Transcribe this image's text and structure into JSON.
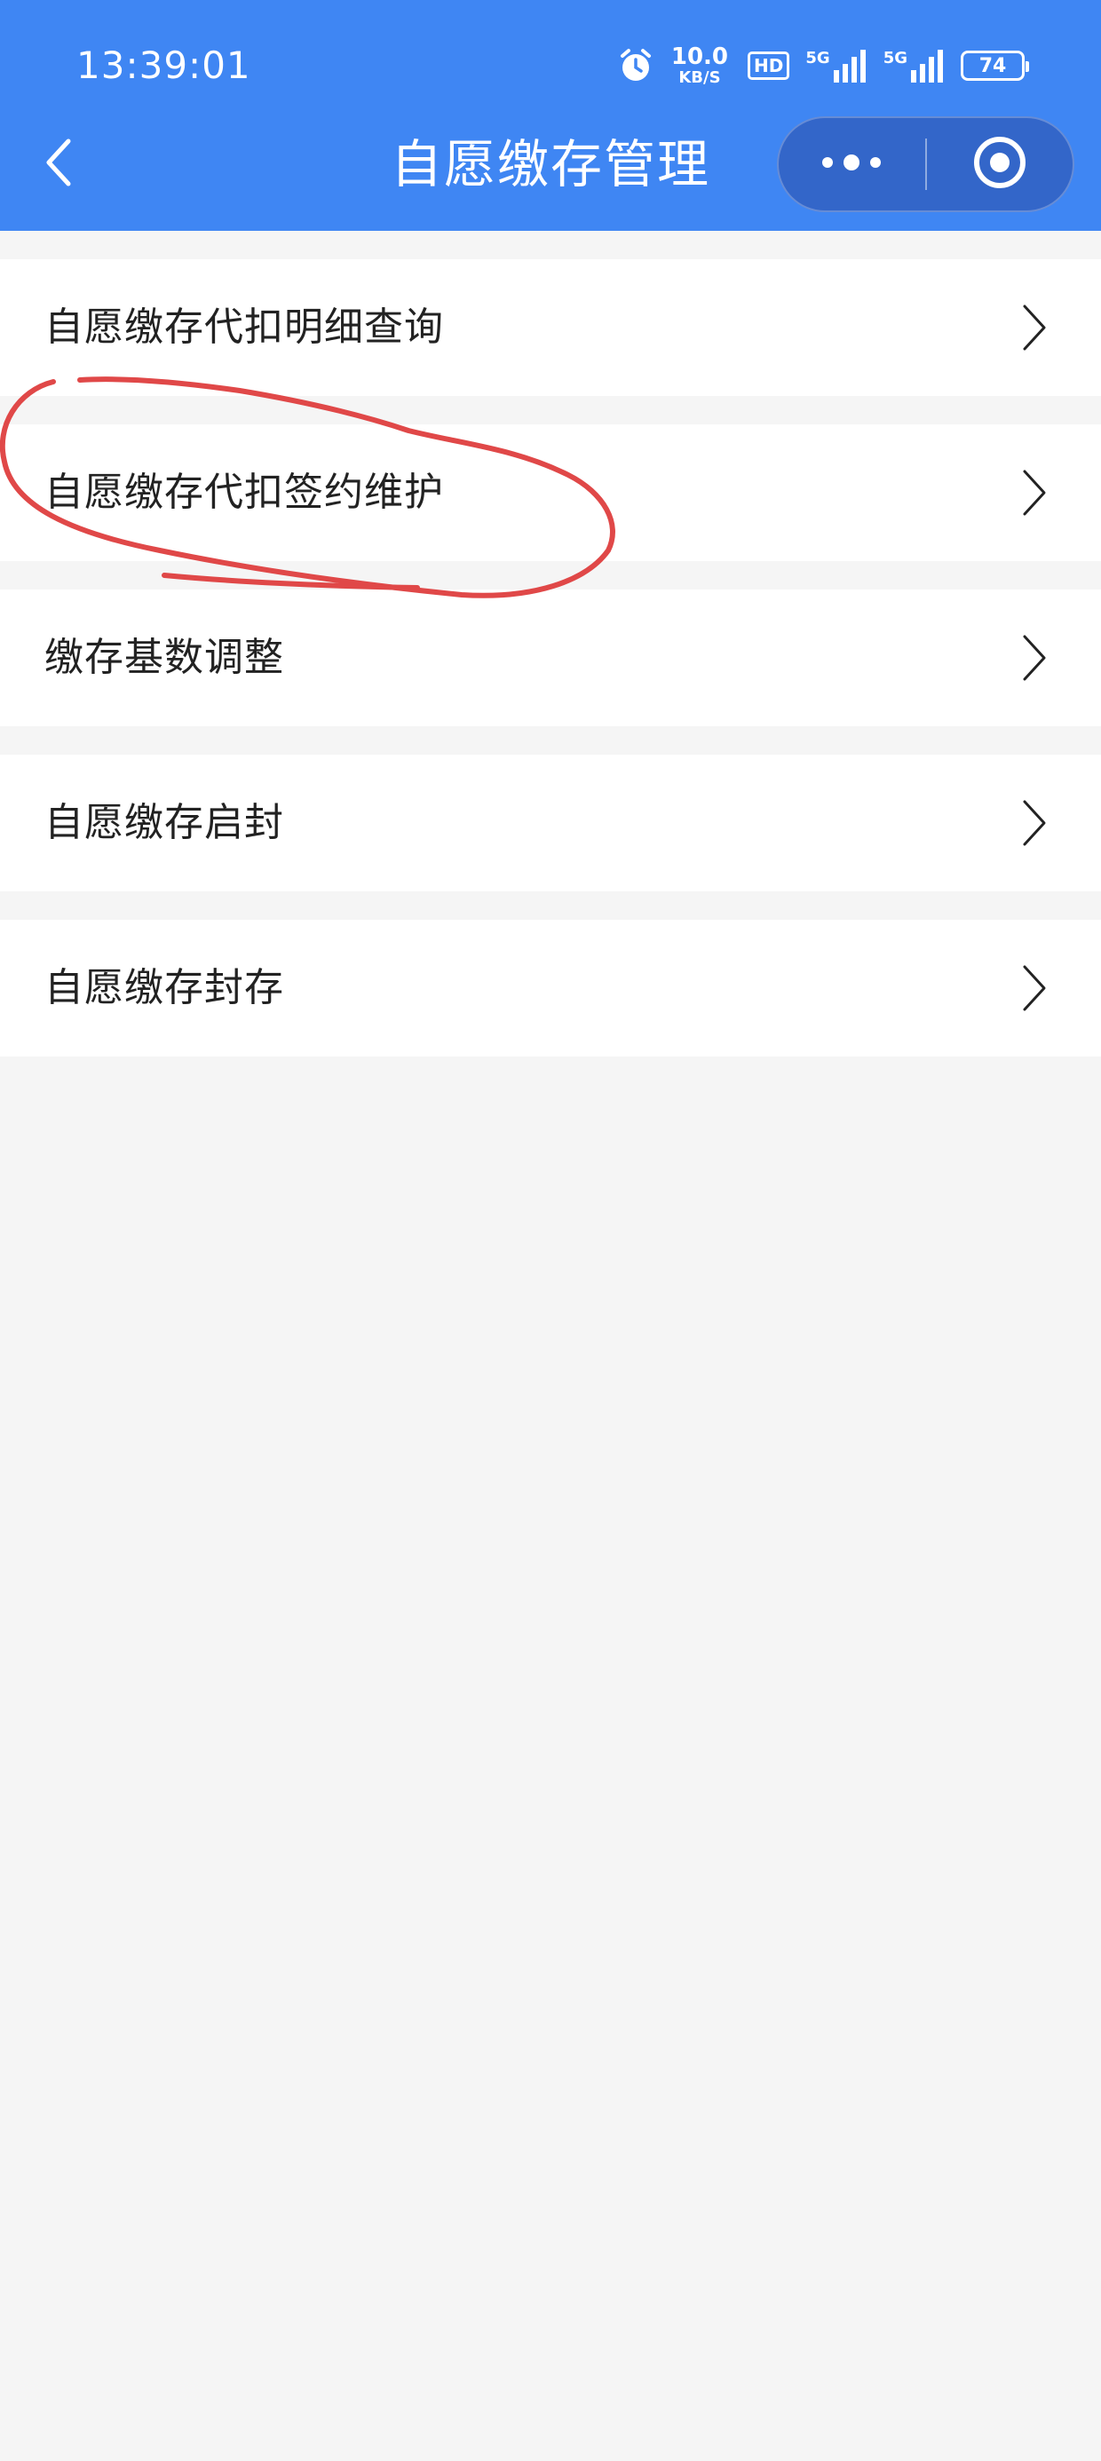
{
  "status_bar": {
    "time": "13:39:01",
    "net_speed_value": "10.0",
    "net_speed_unit": "KB/S",
    "hd_label": "HD",
    "signal_1_label": "5G",
    "signal_2_label": "5G",
    "battery_level": "74",
    "icons": [
      "alarm-icon",
      "hd-voice-icon",
      "signal-5g-icon",
      "signal-5g-icon",
      "battery-icon"
    ]
  },
  "nav": {
    "title": "自愿缴存管理",
    "back_icon": "chevron-left-icon",
    "more_icon": "more-dots-icon",
    "close_icon": "target-circle-icon"
  },
  "menu": {
    "items": [
      {
        "label": "自愿缴存代扣明细查询"
      },
      {
        "label": "自愿缴存代扣签约维护"
      },
      {
        "label": "缴存基数调整"
      },
      {
        "label": "自愿缴存启封"
      },
      {
        "label": "自愿缴存封存"
      }
    ],
    "chevron_icon": "chevron-right-icon"
  },
  "annotation": {
    "color": "#e04848",
    "target": "自愿缴存代扣签约维护"
  },
  "colors": {
    "header_bg": "#3f86f3",
    "capsule_bg": "#3366c9",
    "page_bg": "#f5f5f5",
    "item_bg": "#ffffff",
    "text": "#222222"
  }
}
